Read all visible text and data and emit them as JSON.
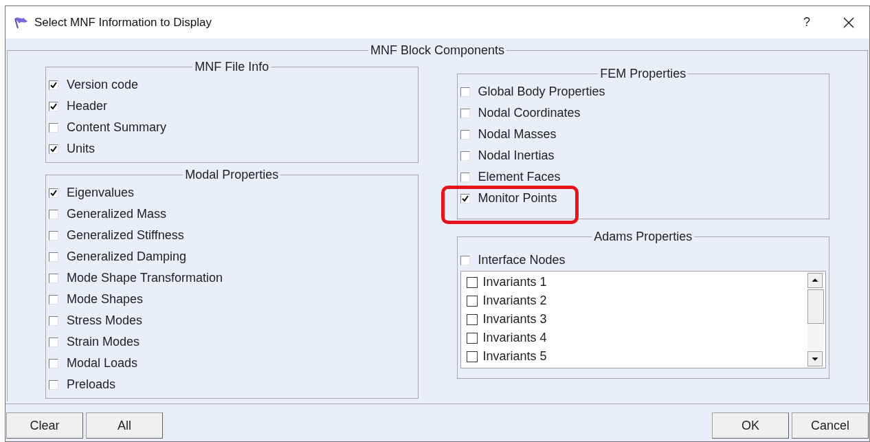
{
  "window": {
    "title": "Select MNF Information to Display",
    "help": "?"
  },
  "block_title": "MNF Block Components",
  "left_groups": [
    {
      "title": "MNF File Info",
      "items": [
        {
          "label": "Version code",
          "checked": true
        },
        {
          "label": "Header",
          "checked": true
        },
        {
          "label": "Content Summary",
          "checked": false
        },
        {
          "label": "Units",
          "checked": true
        }
      ]
    },
    {
      "title": "Modal Properties",
      "items": [
        {
          "label": "Eigenvalues",
          "checked": true
        },
        {
          "label": "Generalized Mass",
          "checked": false
        },
        {
          "label": "Generalized Stiffness",
          "checked": false
        },
        {
          "label": "Generalized Damping",
          "checked": false
        },
        {
          "label": "Mode Shape Transformation",
          "checked": false
        },
        {
          "label": "Mode Shapes",
          "checked": false
        },
        {
          "label": "Stress Modes",
          "checked": false
        },
        {
          "label": "Strain Modes",
          "checked": false
        },
        {
          "label": "Modal Loads",
          "checked": false
        },
        {
          "label": "Preloads",
          "checked": false
        }
      ]
    }
  ],
  "fem_group": {
    "title": "FEM Properties",
    "items": [
      {
        "label": "Global Body Properties",
        "checked": false,
        "highlighted": false
      },
      {
        "label": "Nodal Coordinates",
        "checked": false,
        "highlighted": false
      },
      {
        "label": "Nodal Masses",
        "checked": false,
        "highlighted": false
      },
      {
        "label": "Nodal Inertias",
        "checked": false,
        "highlighted": false
      },
      {
        "label": "Element Faces",
        "checked": false,
        "highlighted": false
      },
      {
        "label": "Monitor Points",
        "checked": true,
        "highlighted": true
      }
    ]
  },
  "adams_group": {
    "title": "Adams Properties",
    "interface_nodes": {
      "label": "Interface Nodes",
      "checked": false
    },
    "list": [
      {
        "label": "Invariants 1",
        "checked": false
      },
      {
        "label": "Invariants 2",
        "checked": false
      },
      {
        "label": "Invariants 3",
        "checked": false
      },
      {
        "label": "Invariants 4",
        "checked": false
      },
      {
        "label": "Invariants 5",
        "checked": false
      }
    ]
  },
  "left_buttons": [
    "Clear",
    "All"
  ],
  "right_buttons": [
    "OK",
    "Cancel"
  ]
}
